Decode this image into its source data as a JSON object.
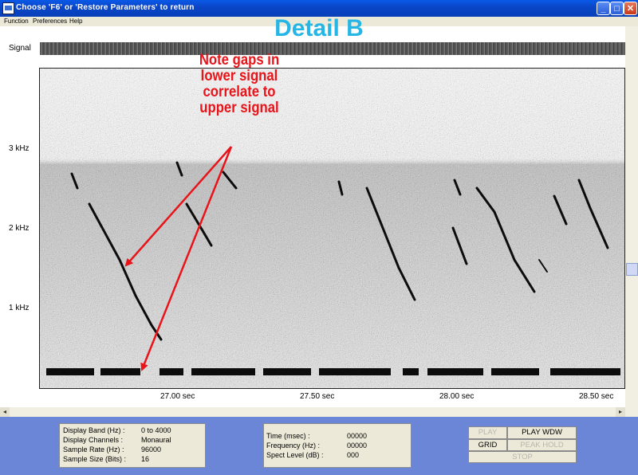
{
  "window": {
    "title": "Choose 'F6' or 'Restore Parameters' to return",
    "min_label": "_",
    "max_label": "□",
    "close_label": "✕"
  },
  "menu": [
    "Function",
    "Preferences",
    "Help"
  ],
  "plot": {
    "heading": "Detail B",
    "signal_label": "Signal",
    "y_ticks": [
      "3 kHz",
      "2 kHz",
      "1 kHz"
    ],
    "x_ticks": [
      "27.00 sec",
      "27.50 sec",
      "28.00 sec",
      "28.50 sec"
    ],
    "annotation": [
      "Note gaps in",
      "lower signal",
      "correlate to",
      "upper signal"
    ],
    "annotation_color": "#e8141a",
    "heading_color": "#25b6e6"
  },
  "display_info": {
    "rows": [
      {
        "label": "Display Band (Hz) :",
        "value": "0 to 4000"
      },
      {
        "label": "Display Channels :",
        "value": "Monaural"
      },
      {
        "label": "Sample Rate (Hz) :",
        "value": "96000"
      },
      {
        "label": "Sample Size (Bits) :",
        "value": "16"
      }
    ]
  },
  "cursor_info": {
    "rows": [
      {
        "label": "Time (msec) :",
        "value": "00000"
      },
      {
        "label": "Frequency (Hz) :",
        "value": "00000"
      },
      {
        "label": "Spect Level (dB) :",
        "value": "000"
      }
    ]
  },
  "controls": {
    "play": "PLAY",
    "play_wdw": "PLAY WDW",
    "grid": "GRID",
    "peak_hold": "PEAK HOLD",
    "stop": "STOP"
  }
}
